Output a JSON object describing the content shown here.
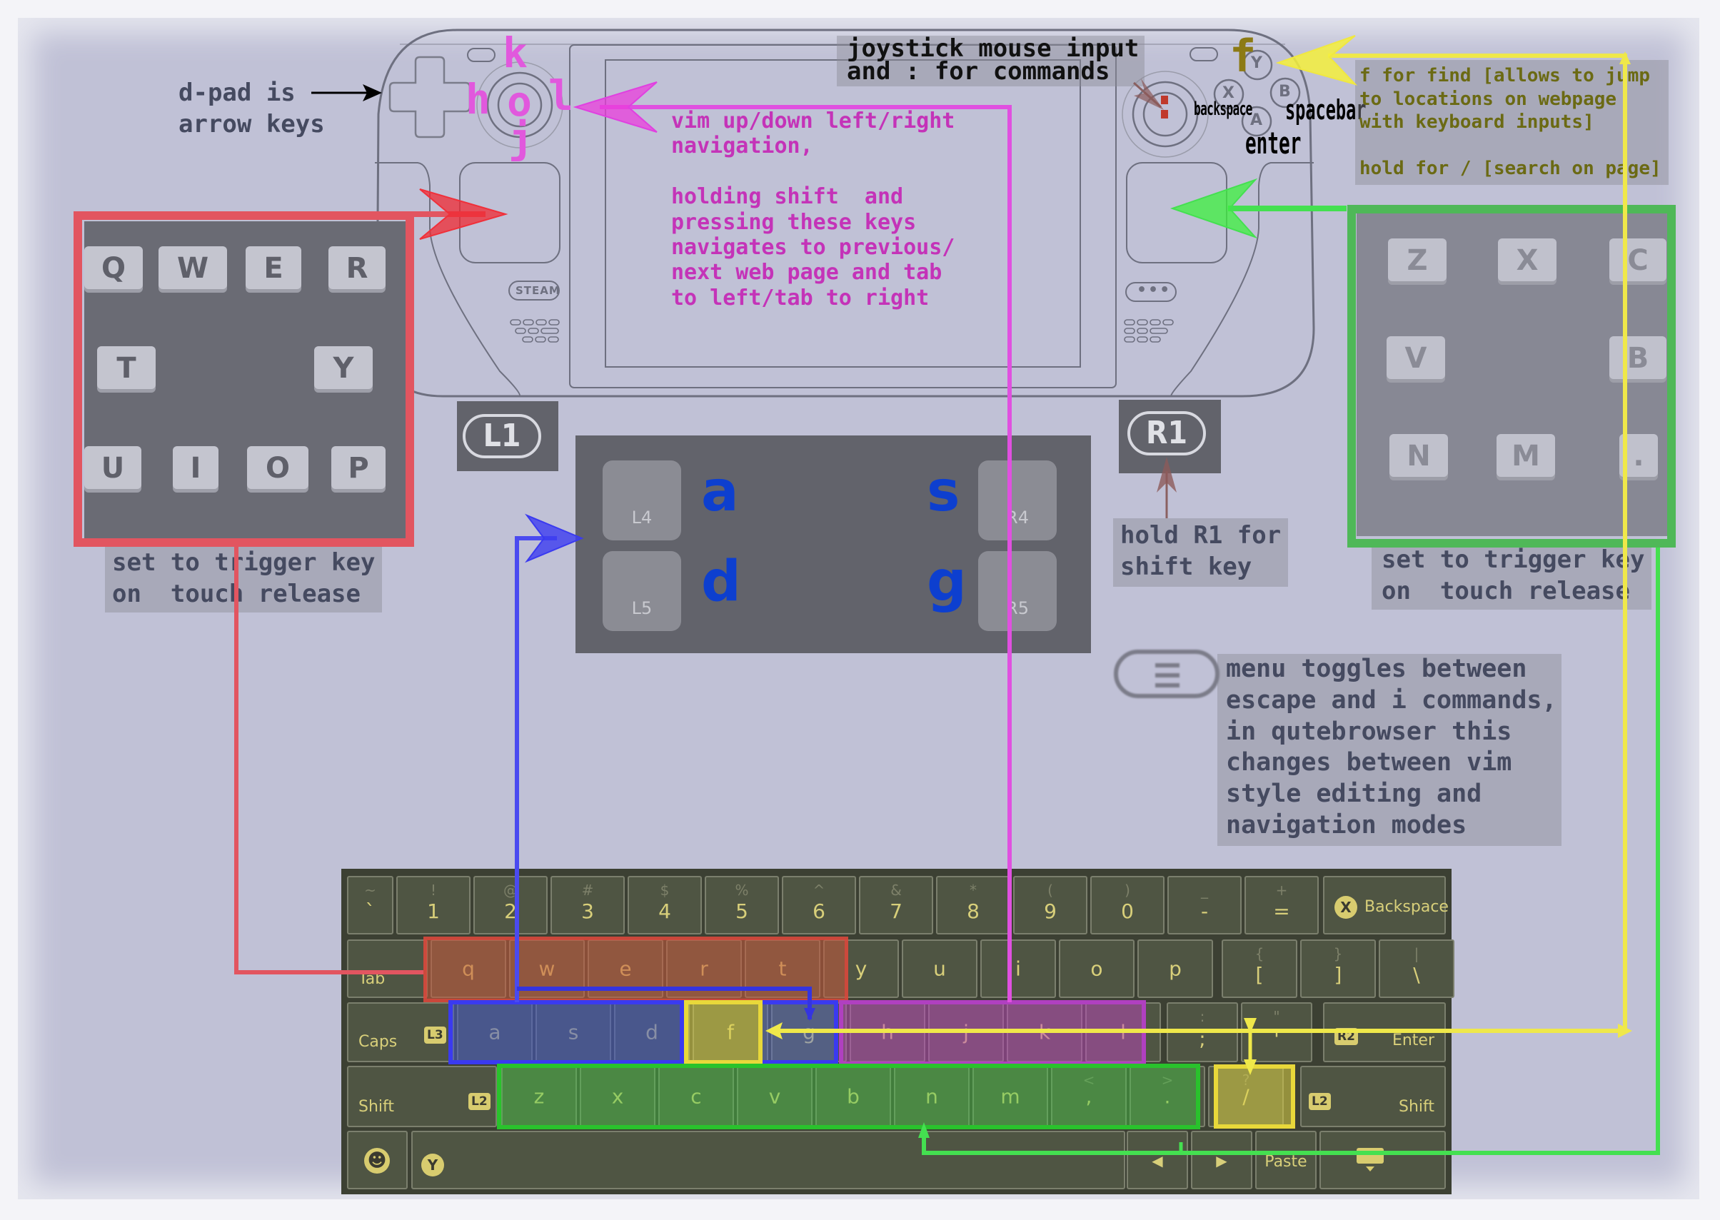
{
  "colors": {
    "red": "#e25560",
    "green": "#3ec24a",
    "blue": "#3a3af0",
    "magenta": "#e050e0",
    "yellow": "#f0e840",
    "note_text": "#454a60",
    "vim_text": "#c433b8",
    "find_text": "#6b6a14",
    "back_letters": "#0d3fcf"
  },
  "annotations": {
    "dpad": "d-pad is\narrow keys",
    "joystick": "joystick mouse input\nand : for commands",
    "vim": "vim up/down left/right\nnavigation,\n\nholding shift  and\npressing these keys\nnavigates to previous/\nnext web page and tab\nto left/tab to right",
    "find": "f for find [allows to jump\nto locations on webpage\nwith keyboard inputs]\n\nhold for / [search on page]",
    "left_pad_caption": "set to trigger key\non  touch release",
    "right_pad_caption": "set to trigger key\non  touch release",
    "r1": "hold R1 for\nshift key",
    "menu": "menu toggles between\nescape and i commands,\nin qutebrowser this\nchanges between vim\nstyle editing and\nnavigation modes"
  },
  "joystick_keys": {
    "up": "k",
    "left": "h",
    "center": "o",
    "right": "l",
    "down": "j"
  },
  "right_stick_glyph": ":",
  "face_buttons": {
    "y": {
      "label": "Y",
      "mapping": "f"
    },
    "x": {
      "label": "X",
      "mapping": "backspace"
    },
    "b": {
      "label": "B",
      "mapping": "spacebar"
    },
    "a": {
      "label": "A",
      "mapping": "enter"
    }
  },
  "device": {
    "steam_label": "STEAM",
    "dots_label": "•••"
  },
  "bumpers": {
    "l1": "L1",
    "r1": "R1"
  },
  "back_buttons": [
    {
      "button": "L4",
      "key": "a"
    },
    {
      "button": "L5",
      "key": "d"
    },
    {
      "button": "R4",
      "key": "s"
    },
    {
      "button": "R5",
      "key": "g"
    }
  ],
  "left_pad_keys": [
    "Q",
    "W",
    "E",
    "R",
    "T",
    "Y",
    "U",
    "I",
    "O",
    "P"
  ],
  "right_pad_keys": [
    "Z",
    "X",
    "C",
    "V",
    "B",
    "N",
    "M",
    "."
  ],
  "keyboard": {
    "row1": [
      {
        "main": "`",
        "shift": "~"
      },
      {
        "main": "1",
        "shift": "!"
      },
      {
        "main": "2",
        "shift": "@"
      },
      {
        "main": "3",
        "shift": "#"
      },
      {
        "main": "4",
        "shift": "$"
      },
      {
        "main": "5",
        "shift": "%"
      },
      {
        "main": "6",
        "shift": "^"
      },
      {
        "main": "7",
        "shift": "&"
      },
      {
        "main": "8",
        "shift": "*"
      },
      {
        "main": "9",
        "shift": "("
      },
      {
        "main": "0",
        "shift": ")"
      },
      {
        "main": "-",
        "shift": "_"
      },
      {
        "main": "=",
        "shift": "+"
      }
    ],
    "backspace": {
      "badge": "X",
      "label": "Backspace"
    },
    "tab": "Tab",
    "row2": [
      "q",
      "w",
      "e",
      "r",
      "t",
      "y",
      "u",
      "i",
      "o",
      "p"
    ],
    "row2_extra": [
      {
        "main": "[",
        "shift": "{"
      },
      {
        "main": "]",
        "shift": "}"
      },
      {
        "main": "\\",
        "shift": "|"
      }
    ],
    "caps": {
      "label": "Caps",
      "badge": "L3"
    },
    "row3": [
      "a",
      "s",
      "d",
      "f",
      "g",
      "h",
      "j",
      "k",
      "l"
    ],
    "row3_extra": [
      {
        "main": ";",
        "shift": ":"
      },
      {
        "main": "'",
        "shift": "\""
      }
    ],
    "enter": {
      "badge": "R2",
      "label": "Enter"
    },
    "shift_left": {
      "label": "Shift",
      "badge": "L2"
    },
    "row4": [
      "z",
      "x",
      "c",
      "v",
      "b",
      "n",
      "m",
      ",",
      ".",
      "/"
    ],
    "row4_shift": [
      "",
      "",
      "",
      "",
      "",
      "",
      "",
      "<",
      ">",
      "?"
    ],
    "shift_right": {
      "label": "Shift",
      "badge": "L2"
    },
    "bottom": {
      "space_badge": "Y",
      "left_arrow": "◀",
      "right_arrow": "▶",
      "paste": "Paste"
    }
  }
}
